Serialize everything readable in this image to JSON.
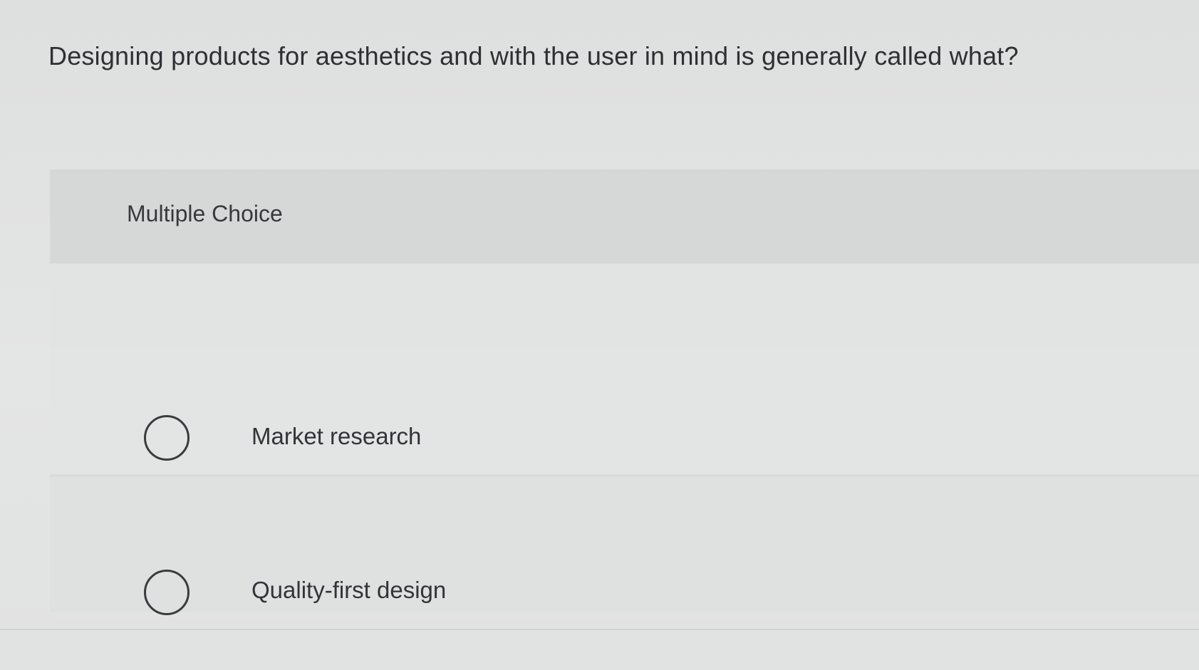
{
  "question": {
    "text": "Designing products for aesthetics and with the user in mind is generally called what?"
  },
  "panel": {
    "title": "Multiple Choice",
    "options": [
      {
        "label": "Market research",
        "selected": false
      },
      {
        "label": "Quality-first design",
        "selected": false
      }
    ]
  }
}
